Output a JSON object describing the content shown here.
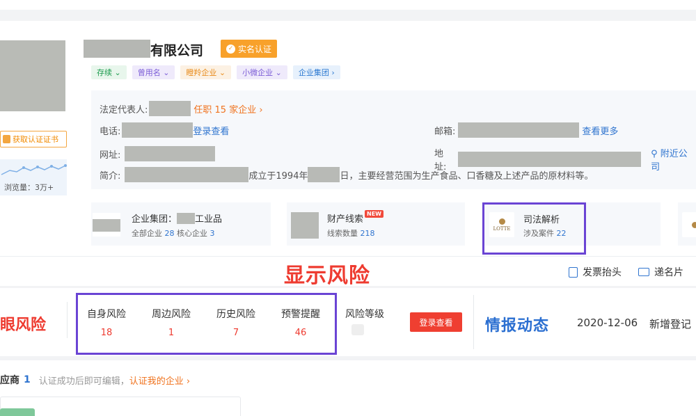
{
  "company": {
    "name_suffix": "有限公司",
    "verified_badge": "实名认证",
    "tags": [
      {
        "label": "存续 ⌄",
        "tone": "green"
      },
      {
        "label": "曾用名 ⌄",
        "tone": "purple"
      },
      {
        "label": "瞪羚企业 ⌄",
        "tone": "orange"
      },
      {
        "label": "小微企业 ⌄",
        "tone": "purple"
      },
      {
        "label": "企业集团 ›",
        "tone": "blue"
      }
    ]
  },
  "sidebar": {
    "cert_button": "获取认证证书",
    "visits": "浏览量：3万+"
  },
  "info": {
    "legal_rep_label": "法定代表人:",
    "legal_rep_link": "任职 15 家企业 ›",
    "phone_label": "电话:",
    "phone_link": "登录查看",
    "email_label": "邮箱:",
    "email_link": "查看更多",
    "website_label": "网址:",
    "address_label": "地址:",
    "address_link": "附近公司",
    "intro_label": "简介:",
    "intro_part1": "成立于1994年",
    "intro_part2": "日，主要经营范围为生产食品、口香糖及上述产品的原材料等。"
  },
  "cards": [
    {
      "title": "企业集团：",
      "title_suffix": "工业品",
      "sub1": "全部企业 ",
      "num1": "28",
      "sub2": "  核心企业 ",
      "num2": "3"
    },
    {
      "title": "财产线索",
      "badge": "NEW",
      "sub1": "线索数量 ",
      "num1": "218"
    },
    {
      "title": "司法解析",
      "sub1": "涉及案件 ",
      "num1": "22",
      "logo_text": "LOTTE"
    }
  ],
  "overlay_label": "显示风险",
  "actions": {
    "invoice": "发票抬头",
    "card": "递名片"
  },
  "risk": {
    "logo": "眼风险",
    "items": [
      {
        "label": "自身风险",
        "value": "18"
      },
      {
        "label": "周边风险",
        "value": "1"
      },
      {
        "label": "历史风险",
        "value": "7"
      },
      {
        "label": "预警提醒",
        "value": "46"
      }
    ],
    "level_label": "风险等级",
    "login_button": "登录查看"
  },
  "intel": {
    "title": "情报动态",
    "date": "2020-12-06",
    "text": "新增登记"
  },
  "supplier": {
    "label": "应商",
    "count": "1",
    "hint": "认证成功后即可编辑，",
    "link": "认证我的企业 ›"
  }
}
